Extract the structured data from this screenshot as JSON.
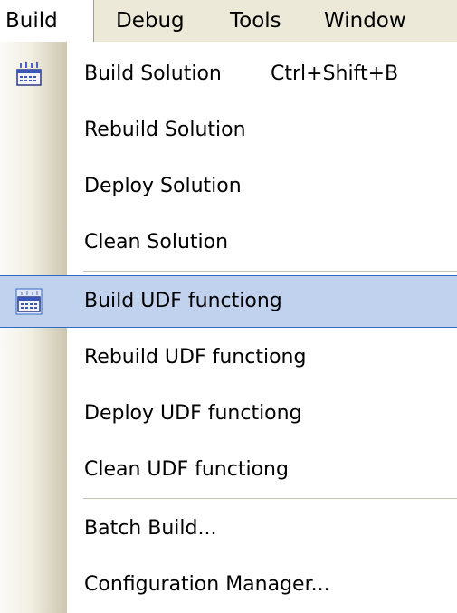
{
  "menubar": {
    "items": [
      {
        "label": "Build"
      },
      {
        "label": "Debug"
      },
      {
        "label": "Tools"
      },
      {
        "label": "Window"
      }
    ]
  },
  "menu": {
    "items": [
      {
        "label": "Build Solution",
        "shortcut": "Ctrl+Shift+B",
        "icon": "build-solution-icon"
      },
      {
        "label": "Rebuild Solution"
      },
      {
        "label": "Deploy Solution"
      },
      {
        "label": "Clean Solution"
      },
      {
        "label": "Build UDF functiong",
        "icon": "build-project-icon",
        "highlighted": true
      },
      {
        "label": "Rebuild UDF functiong"
      },
      {
        "label": "Deploy UDF functiong"
      },
      {
        "label": "Clean UDF functiong"
      },
      {
        "label": "Batch Build..."
      },
      {
        "label": "Configuration Manager..."
      }
    ]
  },
  "colors": {
    "menubar_bg": "#ece9d8",
    "highlight_bg": "#c1d2ee",
    "highlight_border": "#316ac5",
    "separator": "#c5c2b2"
  }
}
